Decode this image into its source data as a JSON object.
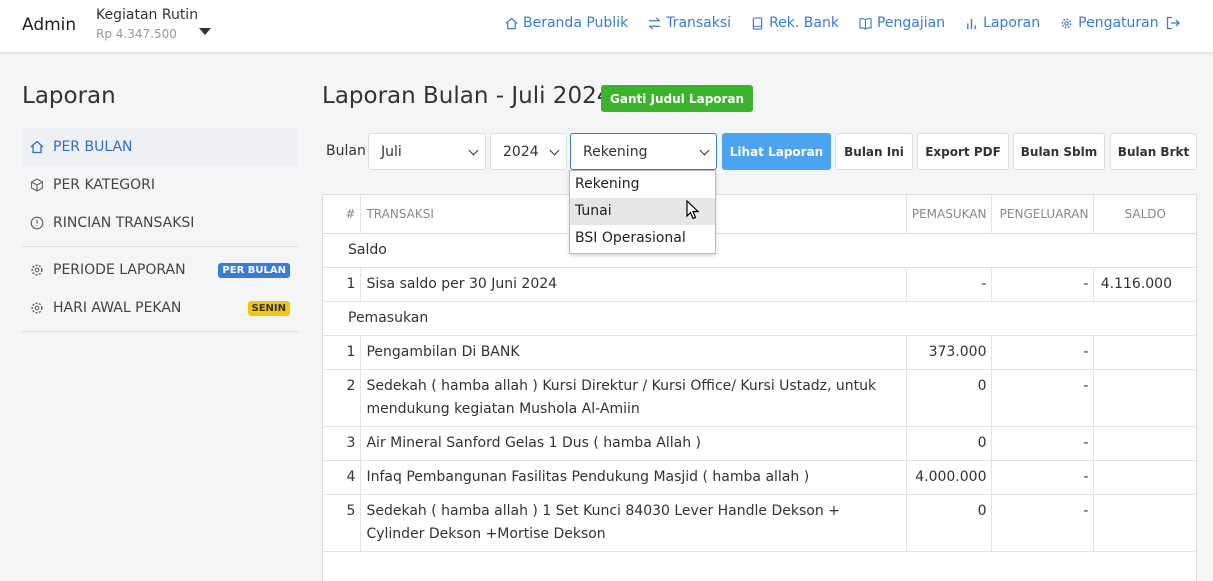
{
  "navbar": {
    "brand": "Admin",
    "account_name": "Kegiatan Rutin",
    "account_balance": "Rp 4.347.500",
    "links": [
      {
        "label": "Beranda Publik",
        "icon": "home-icon"
      },
      {
        "label": "Transaksi",
        "icon": "exchange-icon"
      },
      {
        "label": "Rek. Bank",
        "icon": "book-icon"
      },
      {
        "label": "Pengajian",
        "icon": "open-book-icon"
      },
      {
        "label": "Laporan",
        "icon": "bar-chart-icon"
      },
      {
        "label": "Pengaturan",
        "icon": "gear-icon"
      }
    ],
    "logout_icon": "logout-icon"
  },
  "sidebar": {
    "title": "Laporan",
    "items": [
      {
        "label": "PER BULAN",
        "icon": "home-icon",
        "active": true
      },
      {
        "label": "PER KATEGORI",
        "icon": "cube-icon"
      },
      {
        "label": "RINCIAN TRANSAKSI",
        "icon": "clock-icon"
      }
    ],
    "settings": [
      {
        "label": "PERIODE LAPORAN",
        "icon": "gear-icon",
        "badge": "PER BULAN"
      },
      {
        "label": "HARI AWAL PEKAN",
        "icon": "gear-icon",
        "badge": "SENIN"
      }
    ]
  },
  "main": {
    "title": "Laporan Bulan - Juli 2024",
    "rename_button": "Ganti Judul Laporan",
    "filter": {
      "label": "Bulan",
      "month": "Juli",
      "year": "2024",
      "account": "Rekening",
      "account_options": [
        "Rekening",
        "Tunai",
        "BSI Operasional"
      ],
      "hovered_option": "Tunai",
      "view_button": "Lihat Laporan",
      "this_month_button": "Bulan Ini",
      "export_button": "Export PDF",
      "prev_button": "Bulan Sblm",
      "next_button": "Bulan Brkt"
    },
    "table": {
      "headers": [
        "#",
        "TRANSAKSI",
        "PEMASUKAN",
        "PENGELUARAN",
        "SALDO"
      ],
      "sections": [
        {
          "title": "Saldo",
          "rows": [
            {
              "no": "1",
              "desc": "Sisa saldo per 30 Juni 2024",
              "in": "-",
              "out": "-",
              "balance": "4.116.000"
            }
          ]
        },
        {
          "title": "Pemasukan",
          "rows": [
            {
              "no": "1",
              "desc": "Pengambilan Di BANK",
              "in": "373.000",
              "out": "-",
              "balance": ""
            },
            {
              "no": "2",
              "desc": "Sedekah ( hamba allah ) Kursi Direktur / Kursi Office/ Kursi Ustadz, untuk mendukung kegiatan Mushola Al-Amiin",
              "in": "0",
              "out": "-",
              "balance": ""
            },
            {
              "no": "3",
              "desc": "Air Mineral Sanford Gelas 1 Dus ( hamba Allah )",
              "in": "0",
              "out": "-",
              "balance": ""
            },
            {
              "no": "4",
              "desc": "Infaq Pembangunan Fasilitas Pendukung Masjid ( hamba allah )",
              "in": "4.000.000",
              "out": "-",
              "balance": ""
            },
            {
              "no": "5",
              "desc": "Sedekah ( hamba allah ) 1 Set Kunci 84030 Lever Handle Dekson + Cylinder Dekson +Mortise Dekson",
              "in": "0",
              "out": "-",
              "balance": ""
            }
          ]
        }
      ]
    }
  }
}
